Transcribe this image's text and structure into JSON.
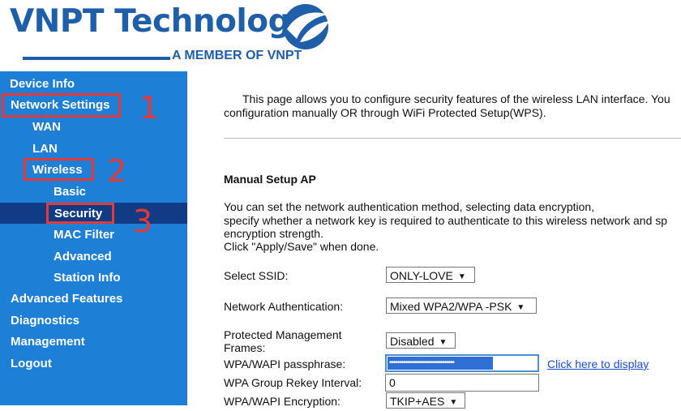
{
  "header": {
    "brand": "VNPT Technology",
    "tagline": "A MEMBER OF VNPT"
  },
  "sidebar": {
    "items": [
      {
        "label": "Device Info"
      },
      {
        "label": "Network Settings"
      },
      {
        "label": "WAN"
      },
      {
        "label": "LAN"
      },
      {
        "label": "Wireless"
      },
      {
        "label": "Basic"
      },
      {
        "label": "Security"
      },
      {
        "label": "MAC Filter"
      },
      {
        "label": "Advanced"
      },
      {
        "label": "Station Info"
      },
      {
        "label": "Advanced Features"
      },
      {
        "label": "Diagnostics"
      },
      {
        "label": "Management"
      },
      {
        "label": "Logout"
      }
    ],
    "active": "Security"
  },
  "annotations": {
    "n1": "1",
    "n2": "2",
    "n3": "3",
    "color": "#e53935"
  },
  "main": {
    "intro_line1": "This page allows you to configure security features of the wireless LAN interface. You",
    "intro_line2": "configuration manually OR through WiFi Protected Setup(WPS).",
    "section_title": "Manual Setup AP",
    "desc_line1": "You can set the network authentication method, selecting data encryption,",
    "desc_line2": "specify whether a network key is required to authenticate to this wireless network and sp",
    "desc_line3": "encryption strength.",
    "desc_line4": "Click \"Apply/Save\" when done.",
    "ssid_label": "Select SSID:",
    "ssid_value": "ONLY-LOVE",
    "auth_label": "Network Authentication:",
    "auth_value": "Mixed WPA2/WPA -PSK",
    "pmf_label1": "Protected Management",
    "pmf_label2": "Frames:",
    "pmf_value": "Disabled",
    "pass_label": "WPA/WAPI passphrase:",
    "pass_masked": "••••••••••••••••••••••••••••••••",
    "pass_link": "Click here to display",
    "rekey_label": "WPA Group Rekey Interval:",
    "rekey_value": "0",
    "enc_label": "WPA/WAPI Encryption:",
    "enc_value": "TKIP+AES"
  },
  "colors": {
    "sidebar_bg": "#1e7fd6",
    "active_bg": "#113b84",
    "brand": "#1f5ea8"
  }
}
